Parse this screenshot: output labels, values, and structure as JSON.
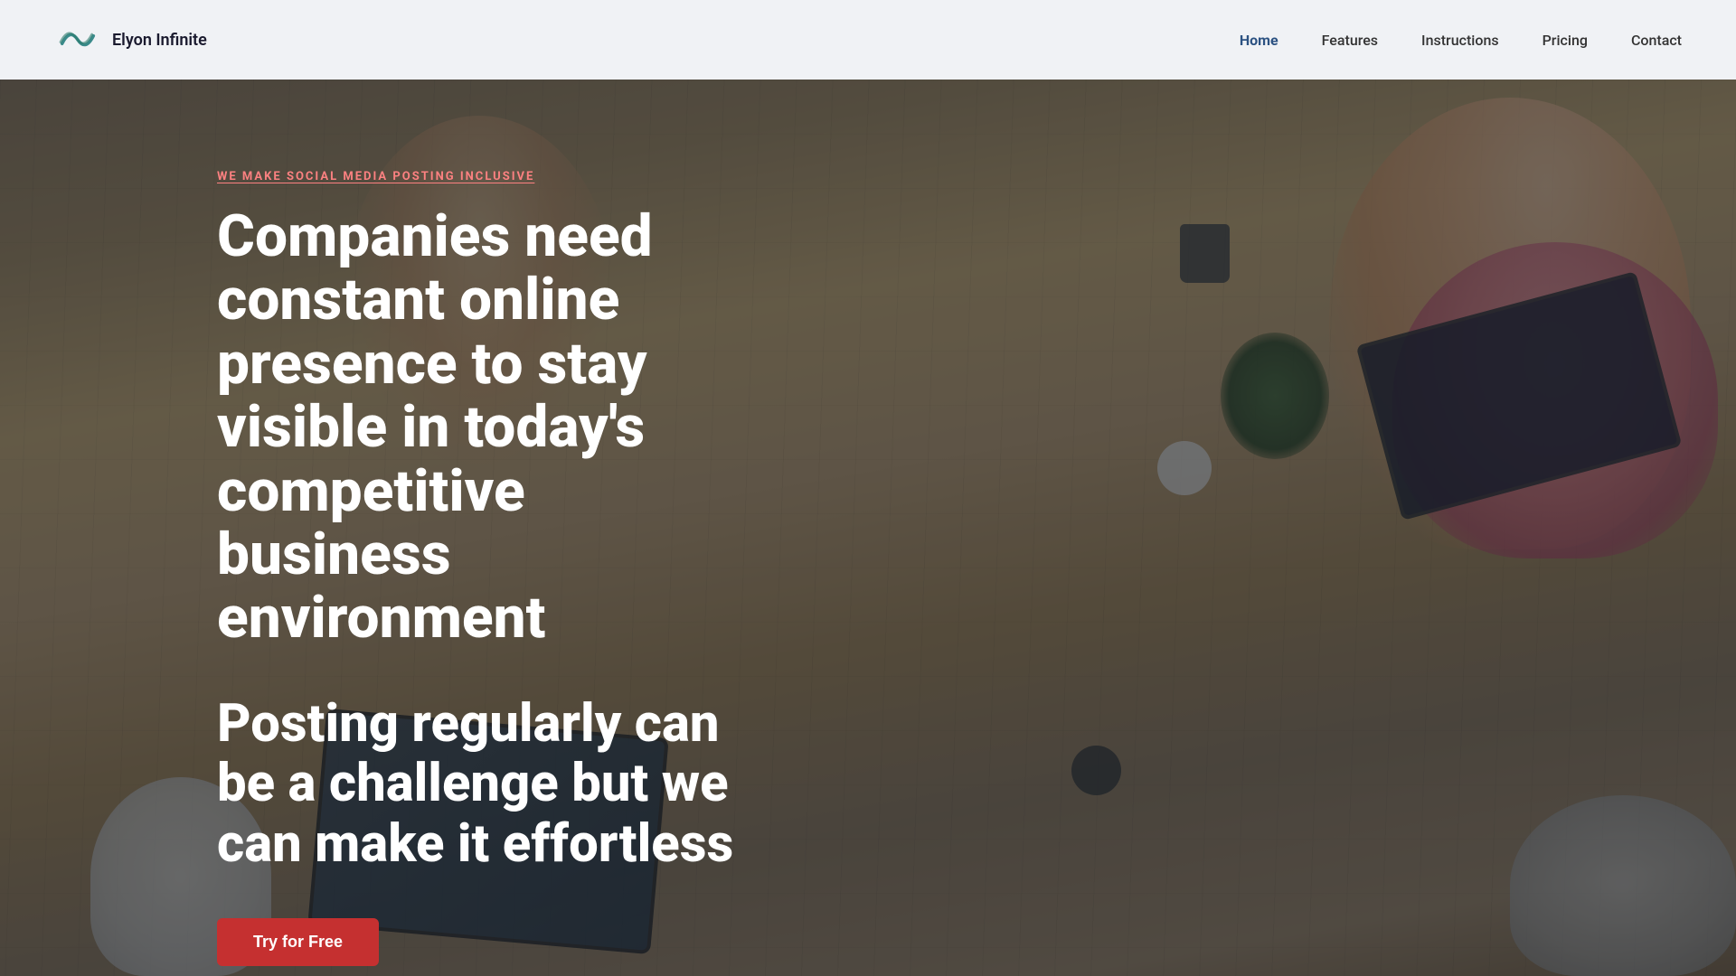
{
  "navbar": {
    "logo_text": "Elyon Infinite",
    "nav_items": [
      {
        "id": "home",
        "label": "Home",
        "active": true
      },
      {
        "id": "features",
        "label": "Features",
        "active": false
      },
      {
        "id": "instructions",
        "label": "Instructions",
        "active": false
      },
      {
        "id": "pricing",
        "label": "Pricing",
        "active": false
      },
      {
        "id": "contact",
        "label": "Contact",
        "active": false
      }
    ]
  },
  "hero": {
    "tagline": "WE MAKE SOCIAL MEDIA POSTING INCLUSIVE",
    "headline": "Companies need constant online presence to stay visible in today's competitive business environment",
    "subtext": "Posting regularly can be a challenge but we can make it effortless",
    "cta_label": "Try for Free"
  },
  "colors": {
    "accent_red": "#c53030",
    "nav_active": "#2c5282",
    "tagline_color": "#fc8181"
  }
}
